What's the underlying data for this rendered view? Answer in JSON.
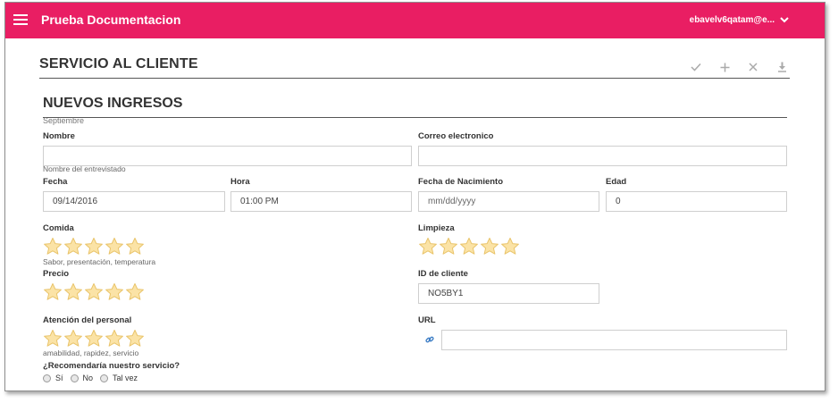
{
  "topbar": {
    "app_title": "Prueba Documentacion",
    "user": "ebavelv6qatam@e...",
    "color": "#e91e63"
  },
  "header": {
    "section_title": "SERVICIO AL CLIENTE",
    "toolbar": [
      "check-icon",
      "plus-icon",
      "close-icon",
      "download-icon"
    ]
  },
  "form": {
    "title": "NUEVOS INGRESOS",
    "subtitle": "Septiembre",
    "nombre": {
      "label": "Nombre",
      "value": "",
      "hint": "Nombre del entrevistado"
    },
    "correo": {
      "label": "Correo electronico",
      "value": ""
    },
    "fecha": {
      "label": "Fecha",
      "value": "09/14/2016"
    },
    "hora": {
      "label": "Hora",
      "value": "01:00 PM"
    },
    "fecha_nacimiento": {
      "label": "Fecha de Nacimiento",
      "placeholder": "mm/dd/yyyy"
    },
    "edad": {
      "label": "Edad",
      "value": "0"
    },
    "comida": {
      "label": "Comida",
      "hint": "Sabor, presentación, temperatura",
      "rating": 0,
      "max": 5
    },
    "limpieza": {
      "label": "Limpieza",
      "rating": 0,
      "max": 5
    },
    "precio": {
      "label": "Precio",
      "rating": 0,
      "max": 5
    },
    "id_cliente": {
      "label": "ID de cliente",
      "value": "NO5BY1"
    },
    "atencion": {
      "label": "Atención del personal",
      "hint": "amabilidad, rapidez, servicio",
      "rating": 0,
      "max": 5
    },
    "url": {
      "label": "URL",
      "value": ""
    },
    "recomendaria": {
      "label": "¿Recomendaría nuestro servicio?",
      "options": [
        "Sí",
        "No",
        "Tal vez"
      ],
      "selected": null
    }
  }
}
